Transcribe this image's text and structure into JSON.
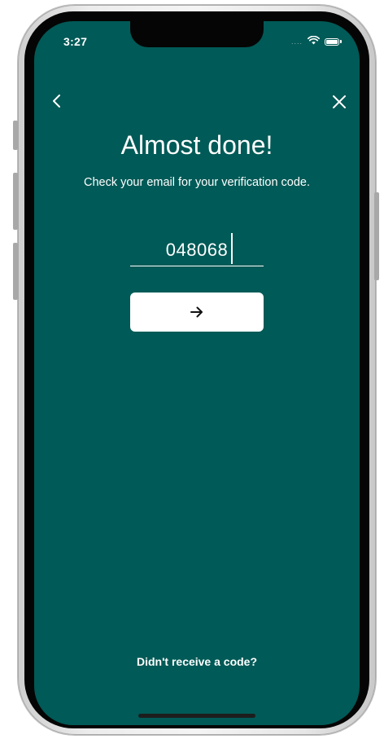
{
  "status_bar": {
    "time": "3:27",
    "signal": "....",
    "wifi_icon": "wifi-icon",
    "battery_icon": "battery-icon"
  },
  "nav": {
    "back_icon": "chevron-left-icon",
    "close_icon": "close-icon"
  },
  "screen": {
    "title": "Almost done!",
    "subtitle": "Check your email for your verification code.",
    "code_value": "048068",
    "submit_icon": "arrow-right-icon",
    "resend_label": "Didn't receive a code?"
  },
  "colors": {
    "background": "#005a57",
    "text": "#ffffff",
    "button_bg": "#ffffff",
    "button_icon": "#111111"
  }
}
